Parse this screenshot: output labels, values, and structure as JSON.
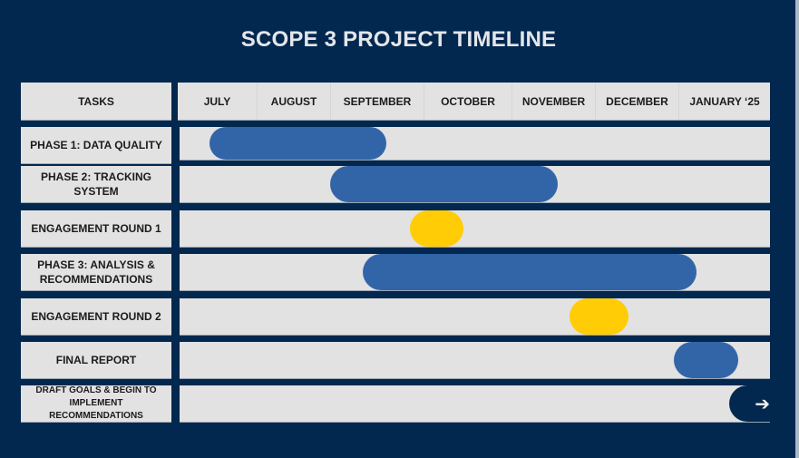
{
  "title": "SCOPE 3 PROJECT TIMELINE",
  "colors": {
    "background": "#02284F",
    "cell": "#E2E2E2",
    "phase": "#3265A8",
    "engagement": "#FFCC05",
    "ongoing": "#02284F"
  },
  "header": {
    "tasks_label": "TASKS",
    "months": [
      "JULY",
      "AUGUST",
      "SEPTEMBER",
      "OCTOBER",
      "NOVEMBER",
      "DECEMBER",
      "JANUARY ‘25"
    ]
  },
  "tasks": [
    {
      "label": "PHASE 1: DATA QUALITY"
    },
    {
      "label": "PHASE 2: TRACKING SYSTEM"
    },
    {
      "label": "ENGAGEMENT ROUND 1"
    },
    {
      "label": "PHASE 3: ANALYSIS & RECOMMENDATIONS"
    },
    {
      "label": "ENGAGEMENT ROUND 2"
    },
    {
      "label": "FINAL REPORT"
    },
    {
      "label": "DRAFT GOALS & BEGIN TO IMPLEMENT RECOMMENDATIONS"
    }
  ],
  "arrow_icon": "➔",
  "chart_data": {
    "type": "gantt",
    "title": "SCOPE 3 PROJECT TIMELINE",
    "categories": [
      "JULY",
      "AUGUST",
      "SEPTEMBER",
      "OCTOBER",
      "NOVEMBER",
      "DECEMBER",
      "JANUARY ‘25"
    ],
    "x_unit": "months from start of July (0 = July 1, 7 = end of January)",
    "xlim": [
      0,
      7
    ],
    "series": [
      {
        "task": "PHASE 1: DATA QUALITY",
        "start": 0.4,
        "end": 2.6,
        "kind": "phase"
      },
      {
        "task": "PHASE 2: TRACKING SYSTEM",
        "start": 2.0,
        "end": 4.55,
        "kind": "phase"
      },
      {
        "task": "ENGAGEMENT ROUND 1",
        "start": 2.85,
        "end": 3.45,
        "kind": "engagement"
      },
      {
        "task": "PHASE 3: ANALYSIS & RECOMMENDATIONS",
        "start": 2.35,
        "end": 6.2,
        "kind": "phase"
      },
      {
        "task": "ENGAGEMENT ROUND 2",
        "start": 4.7,
        "end": 5.4,
        "kind": "engagement"
      },
      {
        "task": "FINAL REPORT",
        "start": 5.95,
        "end": 6.65,
        "kind": "phase"
      },
      {
        "task": "DRAFT GOALS & BEGIN TO IMPLEMENT RECOMMENDATIONS",
        "start": 6.55,
        "end": 7.0,
        "kind": "ongoing"
      }
    ]
  }
}
